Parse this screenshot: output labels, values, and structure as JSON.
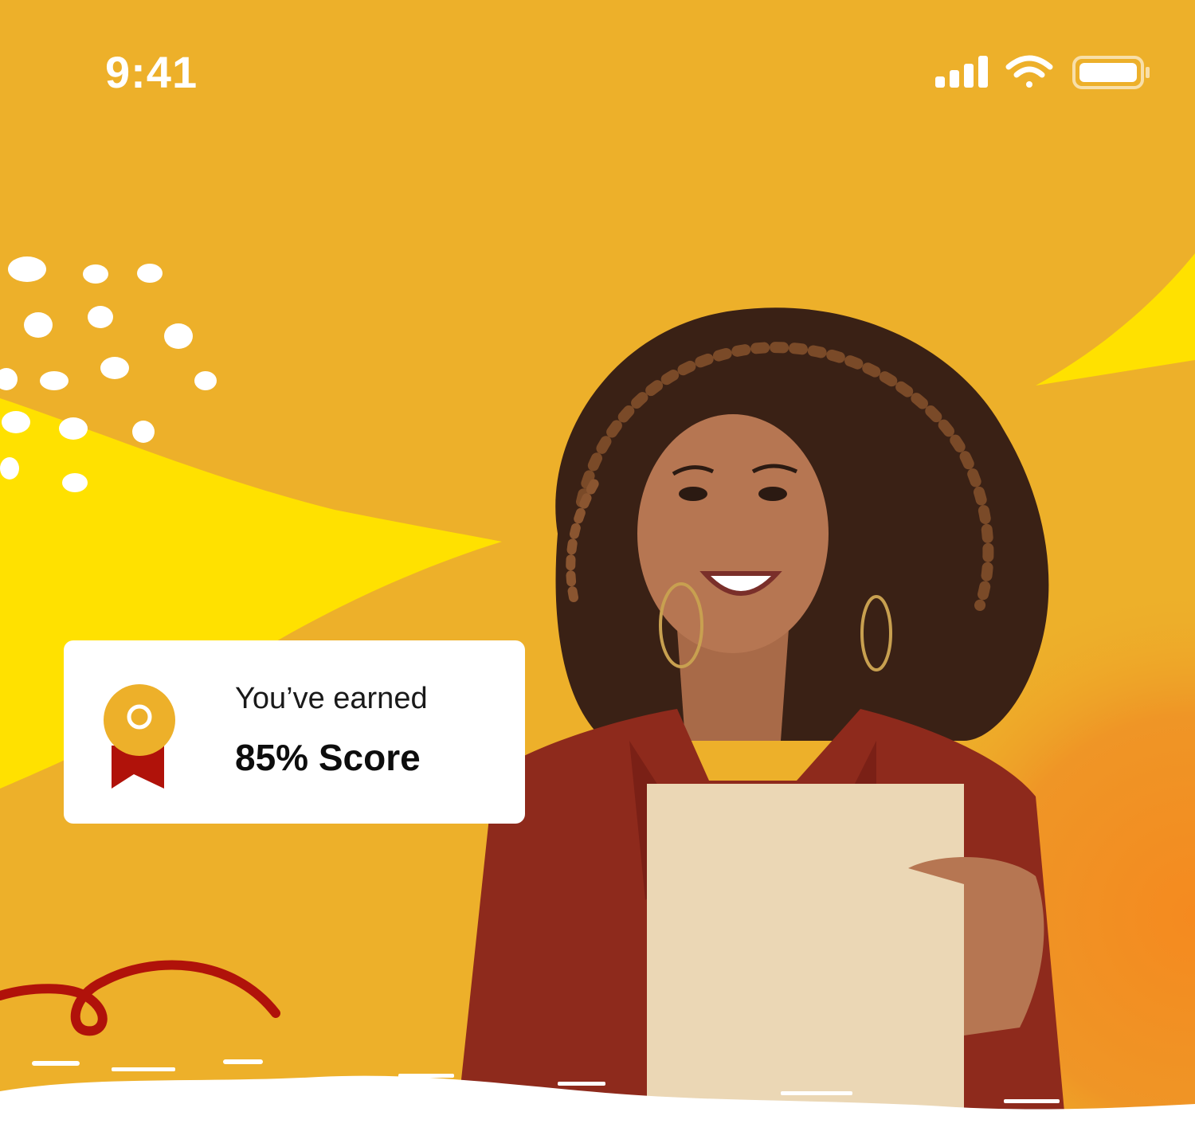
{
  "status_bar": {
    "time": "9:41"
  },
  "score_card": {
    "label": "You’ve earned",
    "value": "85% Score"
  },
  "colors": {
    "background": "#EDB02A",
    "accent_yellow": "#FFE100",
    "accent_red": "#B0120A",
    "card": "#FFFFFF",
    "jacket": "#8E2A1C",
    "paper": "#EBD7B5"
  },
  "icons": [
    "cellular-signal-icon",
    "wifi-icon",
    "battery-icon",
    "award-ribbon-icon"
  ]
}
